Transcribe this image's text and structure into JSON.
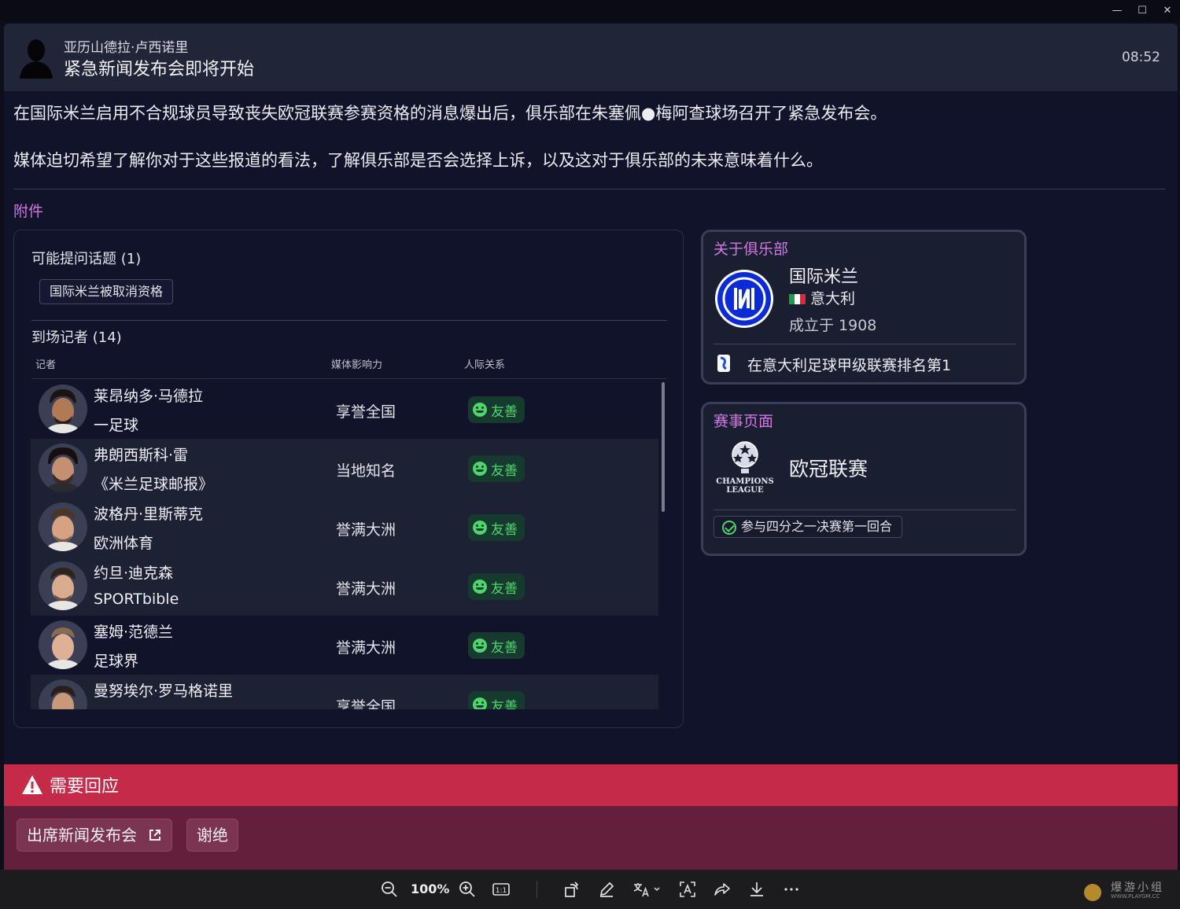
{
  "window": {
    "minimize": "—",
    "maximize": "☐",
    "close": "✕"
  },
  "header": {
    "sender": "亚历山德拉·卢西诺里",
    "subject": "紧急新闻发布会即将开始",
    "time": "08:52"
  },
  "body": {
    "paragraph1": "在国际米兰启用不合规球员导致丧失欧冠联赛参赛资格的消息爆出后，俱乐部在朱塞佩●梅阿查球场召开了紧急发布会。",
    "paragraph2": "媒体迫切希望了解你对于这些报道的看法，了解俱乐部是否会选择上诉，以及这对于俱乐部的未来意味着什么。"
  },
  "attachments_label": "附件",
  "press_panel": {
    "topics_title": "可能提问话题 (1)",
    "topics": [
      "国际米兰被取消资格"
    ],
    "journalists_title": "到场记者 (14)",
    "columns": {
      "journalist": "记者",
      "influence": "媒体影响力",
      "relationship": "人际关系"
    },
    "journalists": [
      {
        "name": "莱昂纳多·马德拉",
        "media": "一足球",
        "influence": "享誉全国",
        "relationship": "友善"
      },
      {
        "name": "弗朗西斯科·雷",
        "media": "《米兰足球邮报》",
        "influence": "当地知名",
        "relationship": "友善"
      },
      {
        "name": "波格丹·里斯蒂克",
        "media": "欧洲体育",
        "influence": "誉满大洲",
        "relationship": "友善"
      },
      {
        "name": "约旦·迪克森",
        "media": "SPORTbible",
        "influence": "誉满大洲",
        "relationship": "友善"
      },
      {
        "name": "塞姆·范德兰",
        "media": "足球界",
        "influence": "誉满大洲",
        "relationship": "友善"
      },
      {
        "name": "曼努埃尔·罗马格诺里",
        "media": "",
        "influence": "享誉全国",
        "relationship": "友善"
      }
    ]
  },
  "club_card": {
    "title": "关于俱乐部",
    "name": "国际米兰",
    "country": "意大利",
    "founded": "成立于 1908",
    "league_rank": "在意大利足球甲级联赛排名第1",
    "colors": {
      "logo_blue": "#0a2bd6",
      "flag_green": "#1f9b4a",
      "flag_red": "#d6293a"
    }
  },
  "competition_card": {
    "title": "赛事页面",
    "name": "欧冠联赛",
    "logo_text_1": "CHAMPIONS",
    "logo_text_2": "LEAGUE",
    "status": "参与四分之一决赛第一回合"
  },
  "response": {
    "banner": "需要回应",
    "attend_button": "出席新闻发布会",
    "decline_button": "谢绝"
  },
  "viewer_toolbar": {
    "zoom": "100%",
    "actual_size": "1:1",
    "watermark_title": "爆游小组",
    "watermark_sub": "WWW.PLAYGM.CC"
  }
}
